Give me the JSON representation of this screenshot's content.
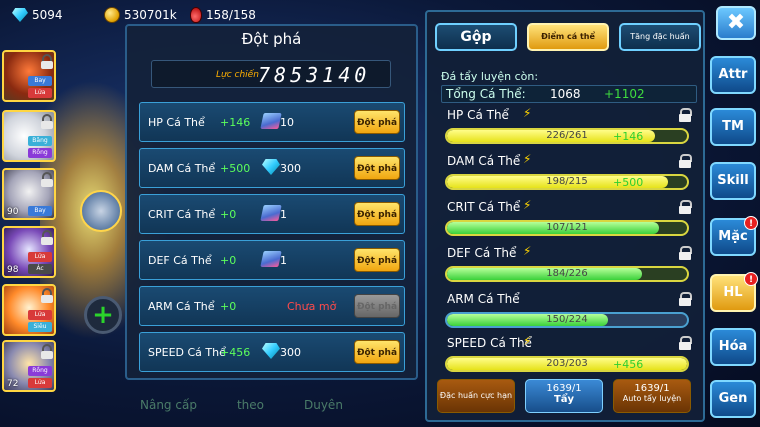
{
  "resources": {
    "gems": "5094",
    "gold": "530701k",
    "stamina": "158/158"
  },
  "pets": [
    {
      "level": "",
      "tags": [
        "Bay",
        "Lửa"
      ]
    },
    {
      "level": "",
      "tags": [
        "Băng",
        "Rồng"
      ]
    },
    {
      "level": "90",
      "tags": [
        "Bay"
      ]
    },
    {
      "level": "98",
      "tags": [
        "Lửa",
        "Ác"
      ]
    },
    {
      "level": "",
      "tags": [
        "Lửa",
        "Siêu"
      ]
    },
    {
      "level": "72",
      "tags": [
        "Rồng",
        "Lửa"
      ]
    }
  ],
  "breakthrough": {
    "title": "Đột phá",
    "power_label": "Lực chiến",
    "power_value": "7853140",
    "button_label": "Đột phá",
    "rows": [
      {
        "label": "HP Cá Thể",
        "bonus": "+146",
        "cost_icon": "scroll-icon",
        "cost": "10",
        "locked": false
      },
      {
        "label": "DAM Cá Thể",
        "bonus": "+500",
        "cost_icon": "diamond-icon",
        "cost": "300",
        "locked": false
      },
      {
        "label": "CRIT Cá Thể",
        "bonus": "+0",
        "cost_icon": "scroll-icon",
        "cost": "1",
        "locked": false
      },
      {
        "label": "DEF Cá Thể",
        "bonus": "+0",
        "cost_icon": "scroll-icon",
        "cost": "1",
        "locked": false
      },
      {
        "label": "ARM Cá Thể",
        "bonus": "+0",
        "cost_icon": "",
        "cost": "",
        "locked": true,
        "locked_text": "Chưa mở"
      },
      {
        "label": "SPEED Cá Thể",
        "bonus": "+456",
        "cost_icon": "diamond-icon",
        "cost": "300",
        "locked": false
      }
    ]
  },
  "bottom_tabs": [
    "Nâng cấp",
    "theo",
    "Duyên"
  ],
  "training": {
    "tabs": [
      "Gộp",
      "Điểm cá thể",
      "Tăng đặc huấn"
    ],
    "remain_label": "Đá tẩy luyện còn:",
    "total_label": "Tổng Cá Thể:",
    "total_value": "1068",
    "total_gain": "+1102",
    "stats": [
      {
        "name": "HP Cá Thể",
        "value": "226/261",
        "ratio": 0.866,
        "gain": "+146",
        "color": "yellow"
      },
      {
        "name": "DAM Cá Thể",
        "value": "198/215",
        "ratio": 0.921,
        "gain": "+500",
        "color": "yellow"
      },
      {
        "name": "CRIT Cá Thể",
        "value": "107/121",
        "ratio": 0.884,
        "gain": "",
        "color": "green"
      },
      {
        "name": "DEF Cá Thể",
        "value": "184/226",
        "ratio": 0.814,
        "gain": "",
        "color": "green"
      },
      {
        "name": "ARM Cá Thể",
        "value": "150/224",
        "ratio": 0.67,
        "gain": "",
        "color": "green"
      },
      {
        "name": "SPEED Cá Thể",
        "value": "203/203",
        "ratio": 1.0,
        "gain": "+456",
        "color": "yellow"
      }
    ],
    "actions": [
      {
        "label": "Đặc huấn cực hạn",
        "count": ""
      },
      {
        "label": "Tẩy",
        "count": "1639/1"
      },
      {
        "label": "Auto tẩy luyện",
        "count": "1639/1"
      }
    ]
  },
  "side_menu": [
    {
      "label": "Attr",
      "badge": ""
    },
    {
      "label": "TM",
      "badge": ""
    },
    {
      "label": "Skill",
      "badge": ""
    },
    {
      "label": "Mặc",
      "badge": "!"
    },
    {
      "label": "HL",
      "badge": "!"
    },
    {
      "label": "Hóa",
      "badge": ""
    },
    {
      "label": "Gen",
      "badge": ""
    }
  ],
  "close_label": "✖"
}
